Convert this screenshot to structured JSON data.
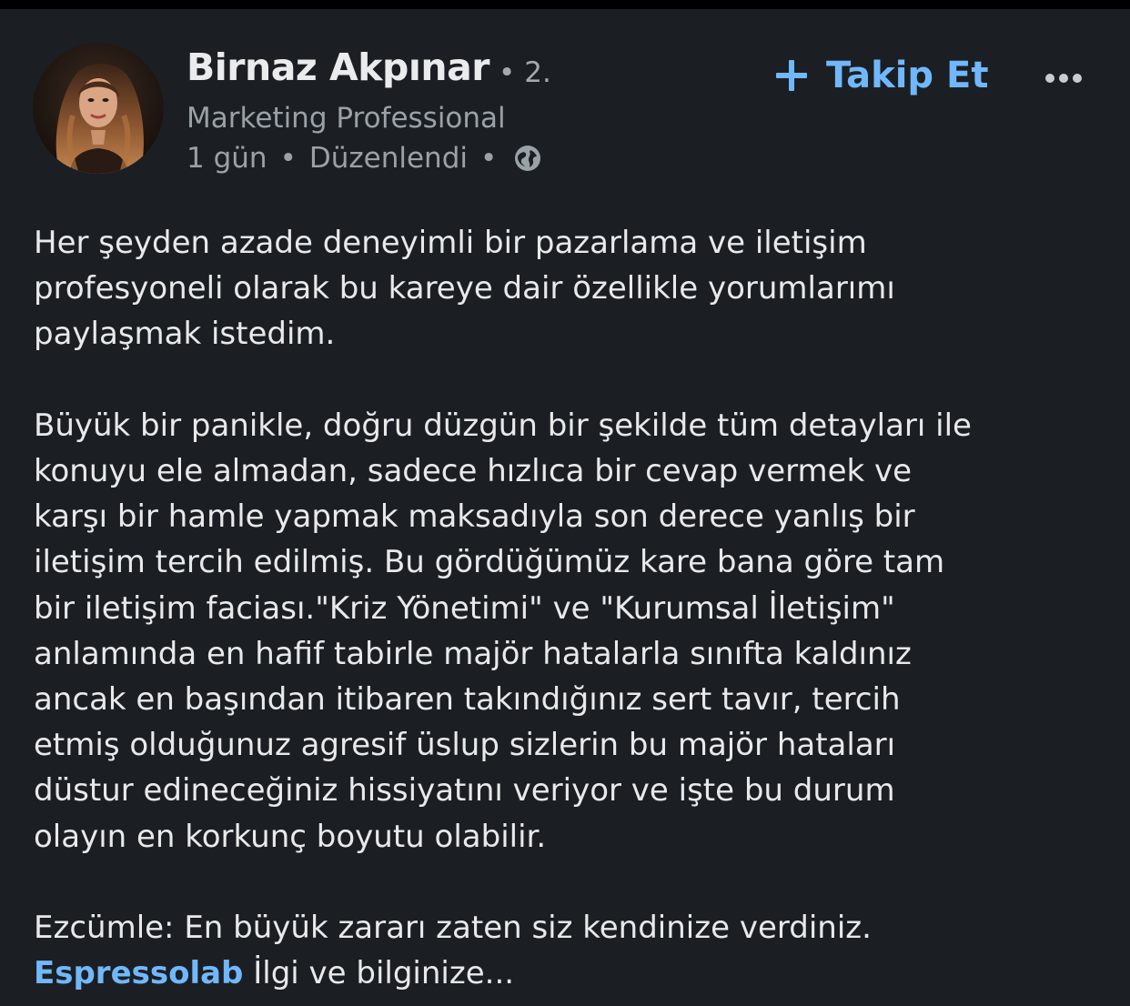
{
  "post": {
    "author": {
      "name": "Birnaz Akpınar",
      "degree_dot": "•",
      "degree": "2.",
      "headline": "Marketing Professional",
      "time": "1 gün",
      "meta_sep": "•",
      "edited": "Düzenlendi",
      "visibility_icon": "globe-icon",
      "avatar_icon": "profile-photo"
    },
    "follow": {
      "icon": "plus-icon",
      "label": "Takip Et"
    },
    "more_icon": "ellipsis-icon",
    "paragraphs": [
      "Her şeyden azade deneyimli bir pazarlama ve iletişim\nprofesyoneli olarak bu kareye dair özellikle yorumlarımı\npaylaşmak istedim.",
      "Büyük bir panikle, doğru düzgün bir şekilde tüm detayları ile\nkonuyu ele almadan, sadece hızlıca  bir cevap vermek ve\nkarşı bir hamle yapmak maksadıyla son derece yanlış bir\niletişim tercih edilmiş. Bu gördüğümüz kare bana göre tam\nbir iletişim faciası.\"Kriz Yönetimi\" ve \"Kurumsal İletişim\"\nanlamında en hafif tabirle majör hatalarla sınıfta kaldınız\nancak en başından itibaren takındığınız sert tavır, tercih\netmiş olduğunuz agresif üslup sizlerin bu majör hataları\ndüstur edineceğiniz hissiyatını veriyor ve işte bu durum\nolayın en korkunç boyutu olabilir.",
      "Ezcümle: En büyük zararı zaten siz kendinize verdiniz."
    ],
    "mention": "Espressolab",
    "truncated_text": " İlgi ve bilginize...",
    "colors": {
      "background": "#1b1f23",
      "text": "#e7e9ea",
      "secondary_text": "#9aa1a7",
      "accent": "#71b7fb"
    }
  }
}
